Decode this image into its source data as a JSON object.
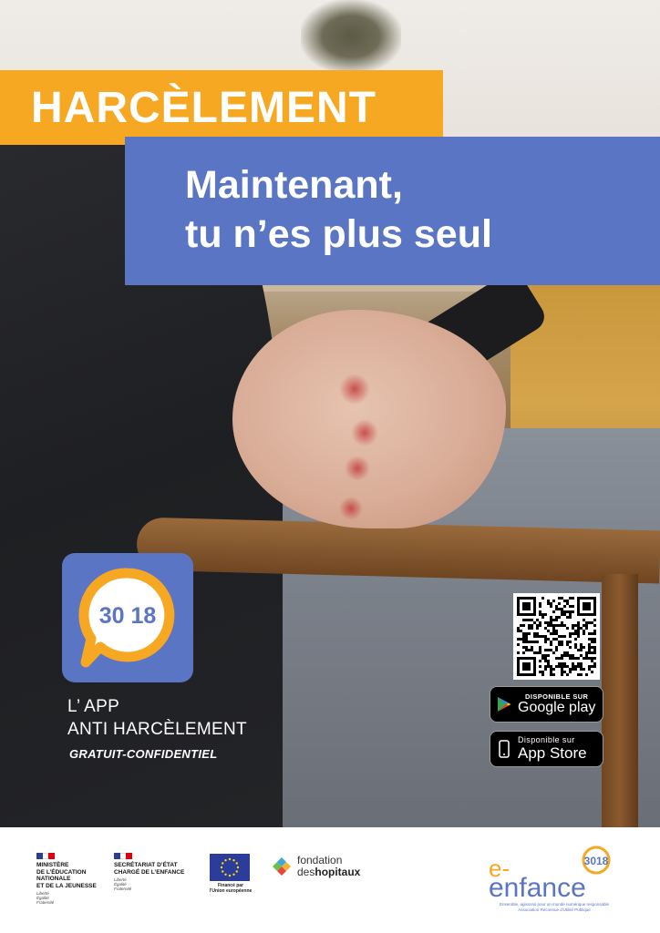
{
  "headline": {
    "title": "HARCÈLEMENT",
    "subtitle_line1": "Maintenant,",
    "subtitle_line2": "tu n’es plus seul"
  },
  "app": {
    "icon_number": "30 18",
    "name_line1": "L’ APP",
    "name_line2": "ANTI HARCÈLEMENT",
    "tagline": "GRATUIT-CONFIDENTIEL"
  },
  "stores": {
    "google_small": "DISPONIBLE SUR",
    "google_big": "Google play",
    "apple_small": "Disponible sur",
    "apple_big": "App Store"
  },
  "footer": {
    "ministere_lines": [
      "MINISTÈRE",
      "DE L’ÉDUCATION",
      "NATIONALE",
      "ET DE LA JEUNESSE"
    ],
    "ministere_motto": [
      "Liberté",
      "Égalité",
      "Fraternité"
    ],
    "secretariat_lines": [
      "SECRÉTARIAT D’ÉTAT",
      "CHARGÉ DE L’ENFANCE"
    ],
    "secretariat_motto": [
      "Liberté",
      "Égalité",
      "Fraternité"
    ],
    "eu_text_line1": "Financé par",
    "eu_text_line2": "l’Union européenne",
    "fondation_line1": "fondation",
    "fondation_line2_a": "des",
    "fondation_line2_b": "hopitaux",
    "eenfance_badge": "3018",
    "eenfance_word_e": "e-",
    "eenfance_word": "enfance",
    "eenfance_tagline": "Ensemble, agissons pour un monde numérique responsable",
    "eenfance_subtag": "Association Reconnue d’Utilité Publique"
  },
  "colors": {
    "yellow": "#f7a823",
    "blue": "#5a75c4"
  }
}
